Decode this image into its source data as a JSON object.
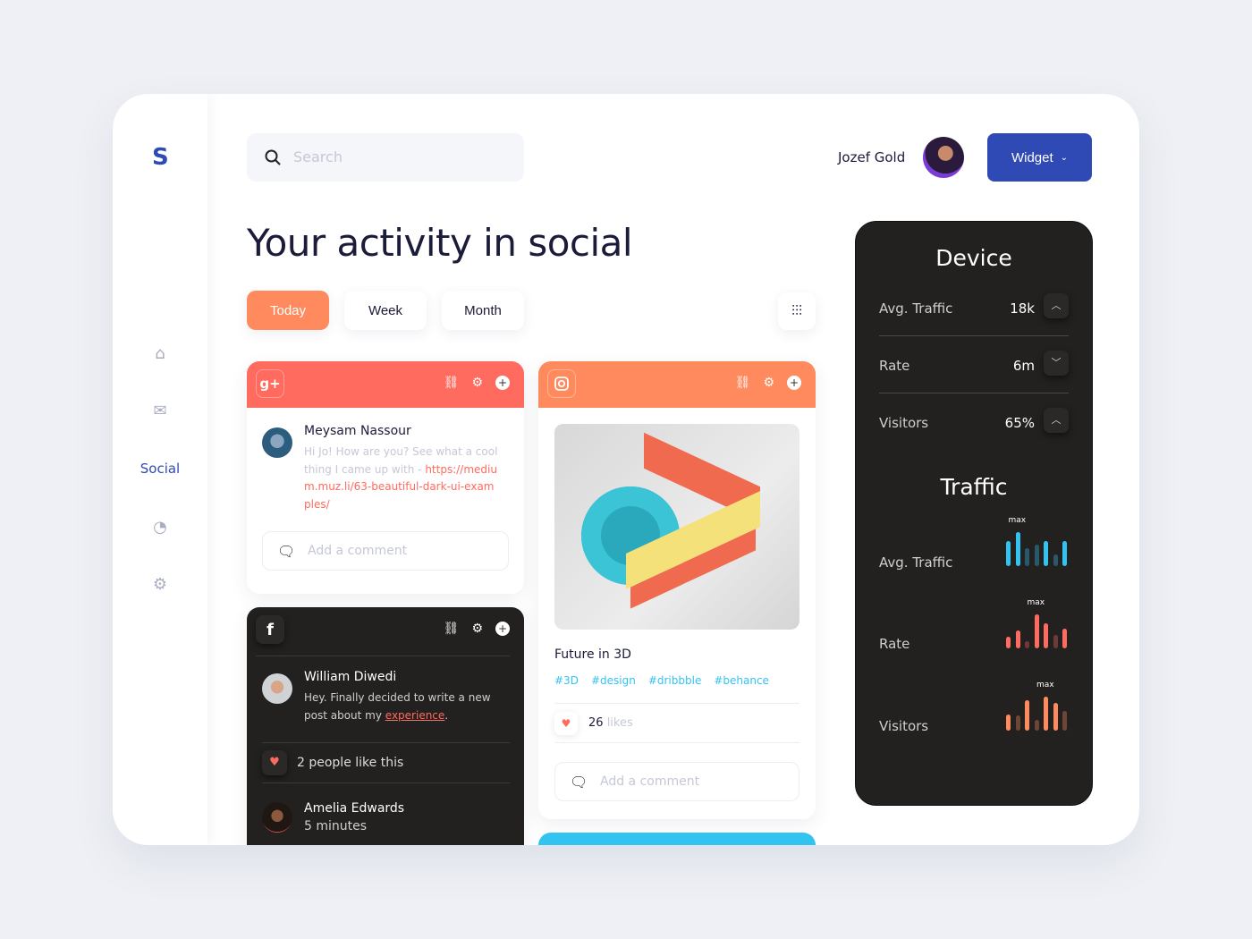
{
  "app": {
    "logo": "S"
  },
  "sidebar": {
    "items": [
      {
        "icon": "home-icon"
      },
      {
        "icon": "mail-icon"
      },
      {
        "label": "Social",
        "active": true
      },
      {
        "icon": "chart-pie-icon"
      },
      {
        "icon": "gear-icon"
      }
    ]
  },
  "header": {
    "search_placeholder": "Search",
    "user_name": "Jozef Gold",
    "widget_label": "Widget"
  },
  "main": {
    "title": "Your activity in social",
    "tabs": [
      "Today",
      "Week",
      "Month"
    ],
    "active_tab": "Today"
  },
  "colors": {
    "accent": "#2f4ab5",
    "coral": "#ff6b5e",
    "orange": "#ff8a5e",
    "cyan": "#33c3f0",
    "dark": "#222120"
  },
  "posts": {
    "gplus": {
      "network": "g+",
      "author": "Meysam Nassour",
      "text": "Hi Jo! How are you? See what a cool thing I came up with - ",
      "link": "https://medium.muz.li/63-beautiful-dark-ui-examples/",
      "comment_placeholder": "Add a comment"
    },
    "facebook": {
      "network": "f",
      "author": "William Diwedi",
      "text": "Hey. Finally decided to write a new post about my ",
      "link": "experience",
      "after": ".",
      "likes_text": "2 people like this",
      "reply_author": "Amelia Edwards",
      "reply_time": "5 minutes"
    },
    "instagram": {
      "title": "Future in 3D",
      "tags": [
        "#3D",
        "#design",
        "#dribbble",
        "#behance"
      ],
      "likes_count": "26",
      "likes_label": "likes",
      "comment_placeholder": "Add a comment"
    }
  },
  "device": {
    "title": "Device",
    "rows": [
      {
        "label": "Avg. Traffic",
        "value": "18k",
        "toggle": "^"
      },
      {
        "label": "Rate",
        "value": "6m",
        "toggle": "v"
      },
      {
        "label": "Visitors",
        "value": "65%",
        "toggle": "^"
      }
    ]
  },
  "chart_data": [
    {
      "type": "bar",
      "title": "Avg. Traffic",
      "annotation": "max",
      "color": "#33c3f0",
      "values": [
        26,
        35,
        18,
        22,
        26,
        12,
        26
      ],
      "highlighted": [
        true,
        true,
        false,
        false,
        true,
        false,
        true
      ]
    },
    {
      "type": "bar",
      "title": "Rate",
      "annotation": "max",
      "color": "#ff6b5e",
      "values": [
        13,
        20,
        8,
        38,
        28,
        15,
        22
      ],
      "highlighted": [
        true,
        true,
        false,
        true,
        true,
        false,
        true
      ]
    },
    {
      "type": "bar",
      "title": "Visitors",
      "annotation": "max",
      "color": "#ff8a5e",
      "values": [
        18,
        17,
        34,
        12,
        38,
        31,
        22
      ],
      "highlighted": [
        true,
        false,
        true,
        false,
        true,
        true,
        false
      ]
    }
  ],
  "traffic": {
    "title": "Traffic"
  }
}
